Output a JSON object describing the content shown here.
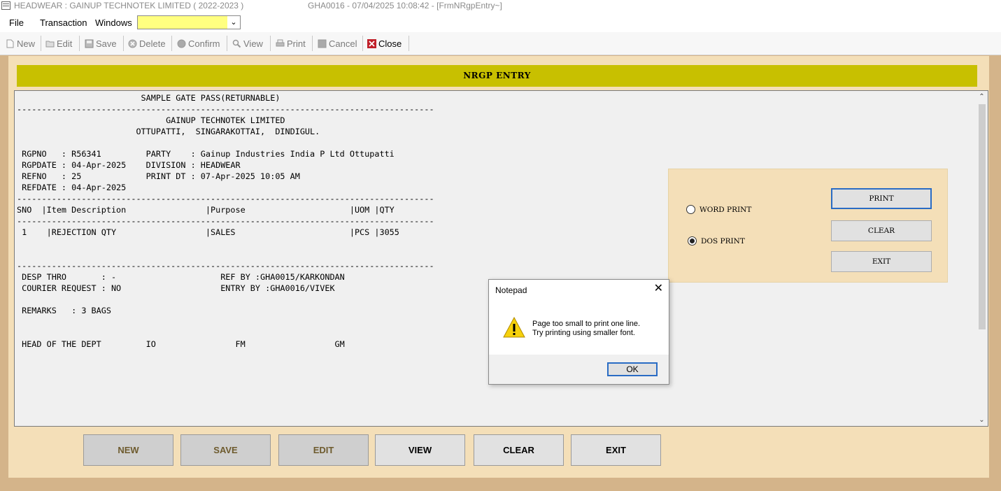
{
  "window": {
    "title": "HEADWEAR : GAINUP TECHNOTEK LIMITED ( 2022-2023 )",
    "subtitle": "GHA0016 - 07/04/2025 10:08:42 - [FrmNRgpEntry~]"
  },
  "menu": {
    "items": [
      "File",
      "Transaction",
      "Windows"
    ],
    "window_combo_value": ""
  },
  "toolbar": {
    "new": "New",
    "edit": "Edit",
    "save": "Save",
    "delete": "Delete",
    "confirm": "Confirm",
    "view": "View",
    "print": "Print",
    "cancel": "Cancel",
    "close": "Close"
  },
  "form": {
    "header": "NRGP ENTRY"
  },
  "report": {
    "lines": [
      "                         SAMPLE GATE PASS(RETURNABLE)",
      "------------------------------------------------------------------------------------",
      "                              GAINUP TECHNOTEK LIMITED",
      "                        OTTUPATTI,  SINGARAKOTTAI,  DINDIGUL.",
      "",
      " RGPNO   : R56341         PARTY    : Gainup Industries India P Ltd Ottupatti",
      " RGPDATE : 04-Apr-2025    DIVISION : HEADWEAR",
      " REFNO   : 25             PRINT DT : 07-Apr-2025 10:05 AM",
      " REFDATE : 04-Apr-2025",
      "------------------------------------------------------------------------------------",
      "SNO  |Item Description                |Purpose                     |UOM |QTY",
      "------------------------------------------------------------------------------------",
      " 1    |REJECTION QTY                  |SALES                       |PCS |3055",
      "",
      "",
      "------------------------------------------------------------------------------------",
      " DESP THRO       : -                     REF BY :GHA0015/KARKONDAN",
      " COURIER REQUEST : NO                    ENTRY BY :GHA0016/VIVEK",
      "",
      " REMARKS   : 3 BAGS",
      "",
      "",
      " HEAD OF THE DEPT         IO                FM                  GM"
    ]
  },
  "print_panel": {
    "word_print": "WORD PRINT",
    "dos_print": "DOS PRINT",
    "selected": "DOS PRINT",
    "print_btn": "PRINT",
    "clear_btn": "CLEAR",
    "exit_btn": "EXIT"
  },
  "bottom_buttons": {
    "new": "NEW",
    "save": "SAVE",
    "edit": "EDIT",
    "view": "VIEW",
    "clear": "CLEAR",
    "exit": "EXIT"
  },
  "dialog": {
    "title": "Notepad",
    "message_line1": "Page too small to print one line.",
    "message_line2": "Try printing using smaller font.",
    "ok": "OK"
  },
  "colors": {
    "background": "#d4b48a",
    "panel": "#f4dfb8",
    "header_bar": "#c8c000",
    "combo": "#ffff80",
    "focus": "#2a6cc4"
  }
}
